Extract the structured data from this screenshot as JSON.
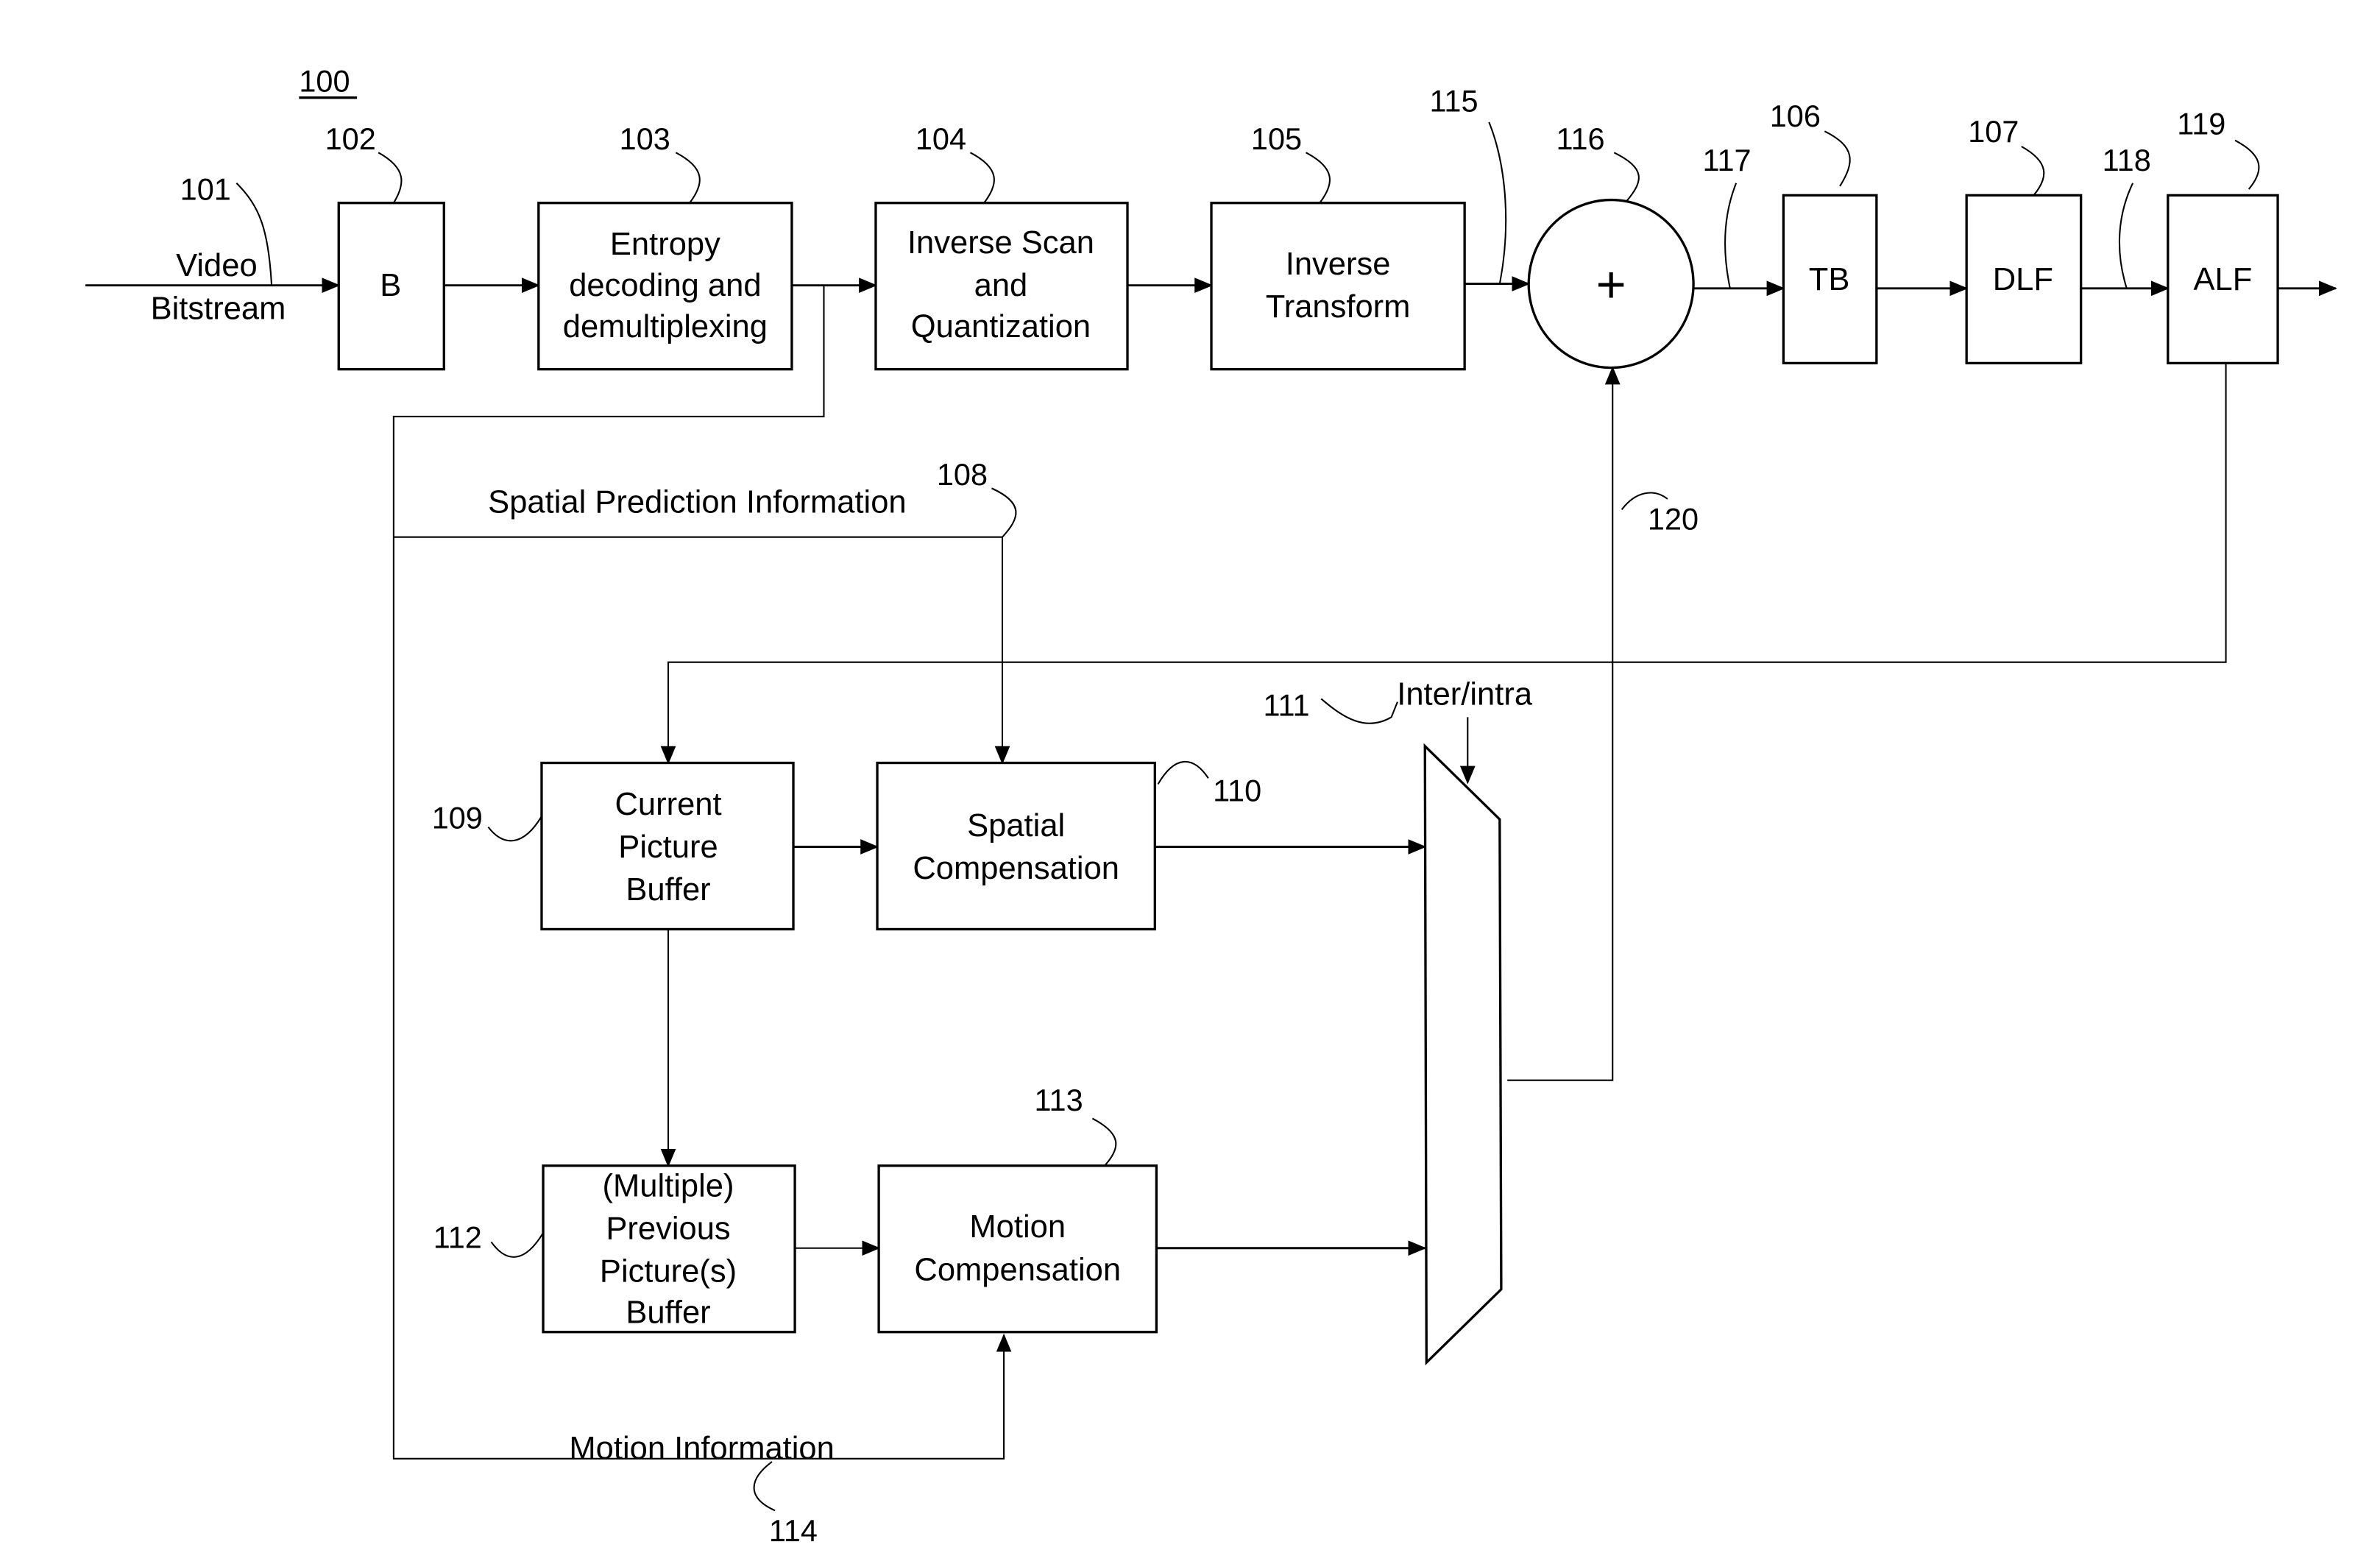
{
  "figure": {
    "number": "100",
    "input_label": [
      "Video",
      "Bitstream"
    ],
    "blocks": {
      "b": {
        "ref": "102",
        "lines": [
          "B"
        ]
      },
      "entropy": {
        "ref": "103",
        "lines": [
          "Entropy",
          "decoding and",
          "demultiplexing"
        ]
      },
      "inv_scan": {
        "ref": "104",
        "lines": [
          "Inverse Scan",
          "and",
          "Quantization"
        ]
      },
      "inv_transform": {
        "ref": "105",
        "lines": [
          "Inverse",
          "Transform"
        ]
      },
      "adder": {
        "ref": "116",
        "symbol": "+"
      },
      "tb": {
        "ref": "106",
        "lines": [
          "TB"
        ]
      },
      "dlf": {
        "ref": "107",
        "lines": [
          "DLF"
        ]
      },
      "alf": {
        "ref": "119",
        "lines": [
          "ALF"
        ]
      },
      "current_buffer": {
        "ref": "109",
        "lines": [
          "Current",
          "Picture",
          "Buffer"
        ]
      },
      "spatial_comp": {
        "ref": "110",
        "lines": [
          "Spatial",
          "Compensation"
        ]
      },
      "prev_buffer": {
        "ref": "112",
        "lines": [
          "(Multiple)",
          "Previous",
          "Picture(s)",
          "Buffer"
        ]
      },
      "motion_comp": {
        "ref": "113",
        "lines": [
          "Motion",
          "Compensation"
        ]
      },
      "switch": {
        "ref": "111",
        "control_label": "Inter/intra"
      }
    },
    "signals": {
      "input": "101",
      "residual": "115",
      "reconstructed": "117",
      "deblocked": "118",
      "prediction": "120",
      "spatial_info": {
        "ref": "108",
        "label": "Spatial Prediction Information"
      },
      "motion_info": {
        "ref": "114",
        "label": "Motion Information"
      }
    }
  }
}
